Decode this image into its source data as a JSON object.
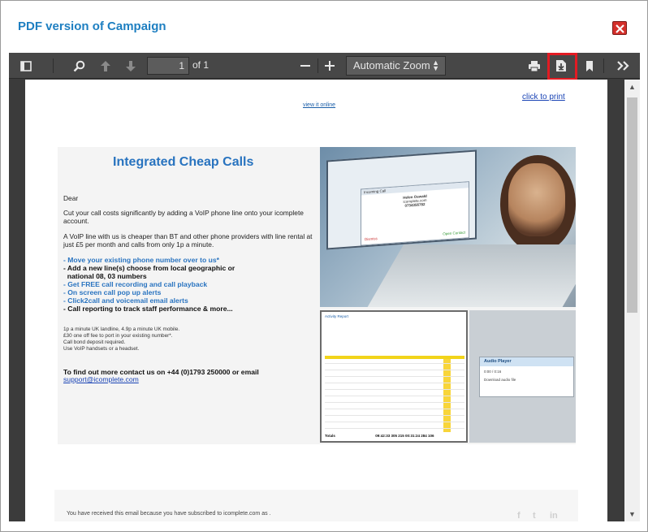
{
  "dialog": {
    "title": "PDF version of Campaign",
    "close_icon": "close-x-icon",
    "close_color": "#d4302b",
    "title_color": "#1e7fc1"
  },
  "toolbar": {
    "sidebar_icon": "sidebar-toggle-icon",
    "search_icon": "search-icon",
    "prev_icon": "arrow-up-icon",
    "next_icon": "arrow-down-icon",
    "page_number": "1",
    "page_of": "of 1",
    "zoom_out_icon": "minus-icon",
    "zoom_in_icon": "plus-icon",
    "zoom_value": "Automatic Zoom",
    "print_icon": "print-icon",
    "download_icon": "download-icon",
    "bookmark_icon": "bookmark-icon",
    "more_icon": "double-chevron-right-icon",
    "highlight_color": "#e21b23"
  },
  "document": {
    "view_online": "view it online",
    "click_to_print": "click to print",
    "heading": "Integrated Cheap Calls",
    "dear": "Dear",
    "para1": "Cut your call costs significantly by adding a VoIP phone line onto your icomplete account.",
    "para2": "A VoIP line with us is cheaper than BT and other phone providers with line rental at just £5 per month and calls from only 1p a minute.",
    "bullets": [
      {
        "text": "- Move your existing phone number over to us*",
        "color": "blue"
      },
      {
        "text": "- Add a new line(s) choose from local geographic or",
        "color": "black"
      },
      {
        "text": "  national 08, 03 numbers",
        "color": "black"
      },
      {
        "text": "- Get FREE call recording and call playback",
        "color": "blue"
      },
      {
        "text": "- On screen call pop up alerts",
        "color": "blue"
      },
      {
        "text": "- Click2call and voicemail email alerts",
        "color": "blue"
      },
      {
        "text": "- Call reporting to track staff performance & more...",
        "color": "black"
      }
    ],
    "small_print": [
      "1p a minute UK landline, 4.9p a minute UK mobile.",
      "£30 one off fee to port in your existing number*.",
      "Call bond deposit required.",
      "Use VoIP handsets or a headset."
    ],
    "contact": "To find out more contact us on +44 (0)1793 250000 or email",
    "support_email": "support@icomplete.com",
    "popup": {
      "title": "Incoming Call",
      "name": "Helen Oswald",
      "company": "icomplete.com",
      "number": "0734356782",
      "dismiss": "Dismiss",
      "open": "Open Contact"
    },
    "report": {
      "title": "Activity Report",
      "totals_label": "Totals",
      "totals_values": "09:42:33    305    215    00:31:24    284    106"
    },
    "audio": {
      "title": "Audio Player",
      "time": "0:00 / 0:16",
      "link": "Download audio file"
    },
    "footer": "You have received this email because you have subscribed to icomplete.com as ."
  }
}
